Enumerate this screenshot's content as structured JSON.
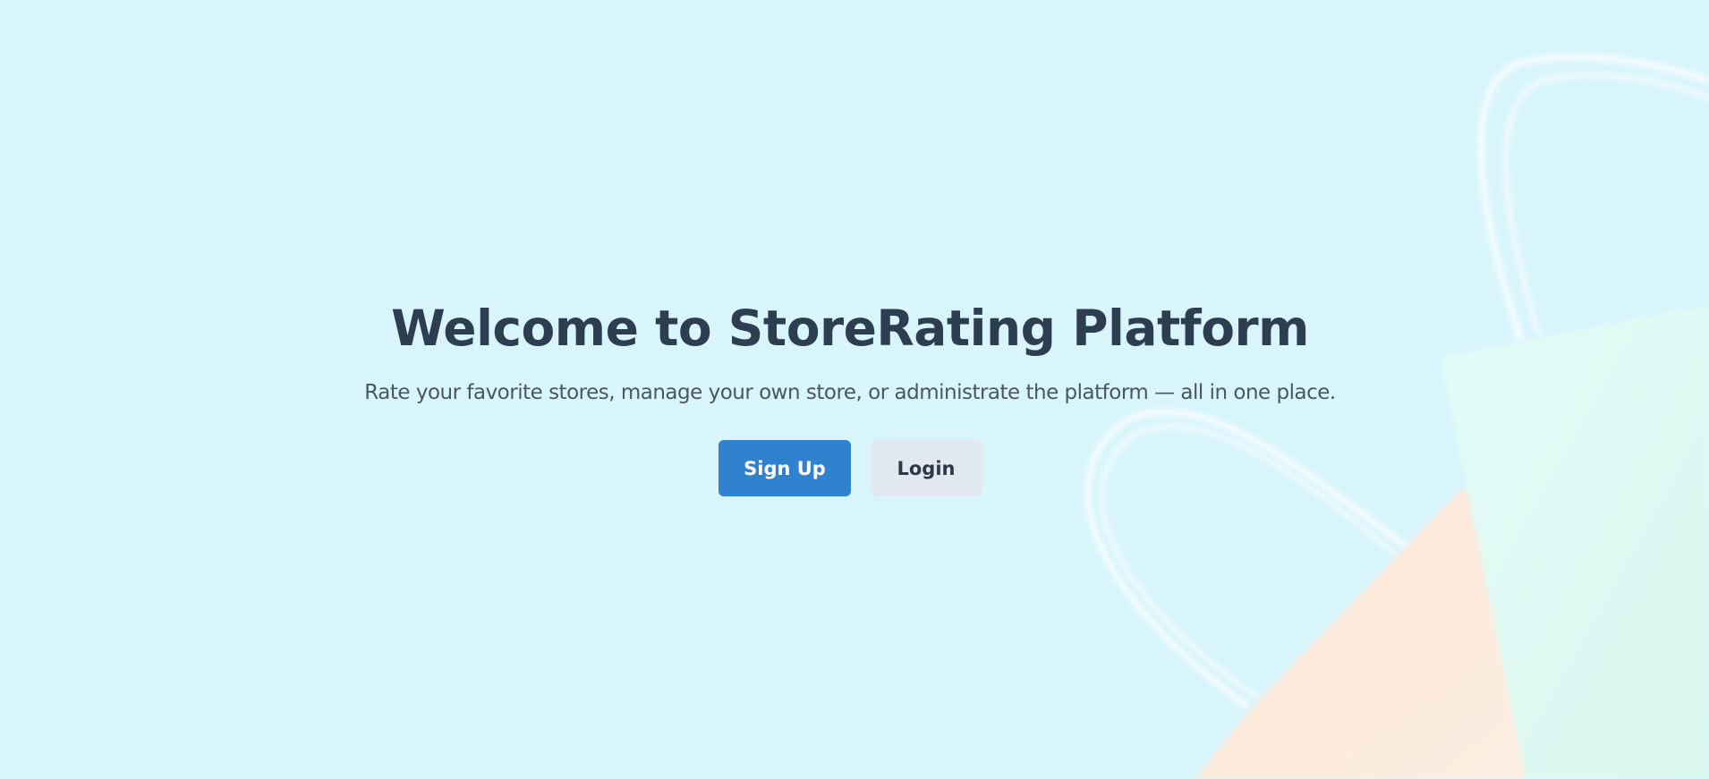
{
  "hero": {
    "title": "Welcome to StoreRating Platform",
    "subtitle": "Rate your favorite stores, manage your own store, or administrate the platform — all in one place."
  },
  "actions": {
    "signup_label": "Sign Up",
    "login_label": "Login"
  },
  "colors": {
    "background": "#d8f5fc",
    "primary": "#3182ce",
    "secondary": "#e2e8f0",
    "heading": "#2c3e50"
  },
  "background_image": "shopping-bags-photo"
}
